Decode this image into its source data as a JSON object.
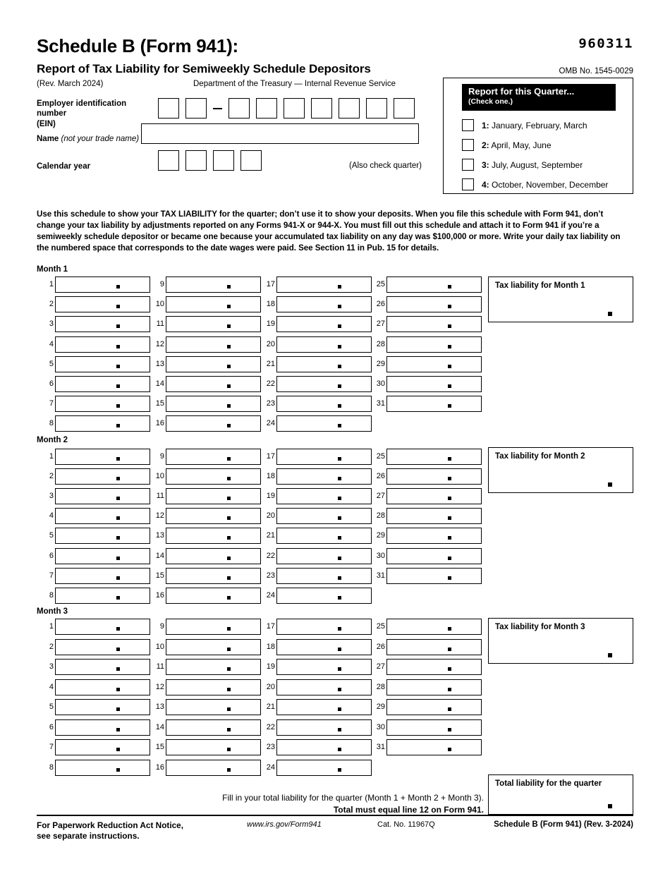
{
  "header": {
    "title": "Schedule B (Form 941):",
    "subtitle": "Report of Tax Liability for Semiweekly Schedule Depositors",
    "revision": "(Rev. March 2024)",
    "agency": "Department of the Treasury  —  Internal Revenue Service",
    "scanline": "960311",
    "omb": "OMB No. 1545-0029"
  },
  "identity": {
    "ein_label_line1": "Employer identification number",
    "ein_label_line2": "(EIN)",
    "ein_boxes_before_dash": 2,
    "ein_boxes_after_dash": 7,
    "ein_value": "",
    "name_label_bold": "Name",
    "name_label_italic": "(not your trade name)",
    "name_value": "",
    "calendar_year_label": "Calendar year",
    "calendar_year_boxes": 4,
    "calendar_year_value": "",
    "also_check_quarter": "(Also check quarter)"
  },
  "quarter": {
    "title": "Report for this Quarter...",
    "subtitle": "(Check one.)",
    "options": [
      {
        "number": "1:",
        "months": "January, February, March",
        "checked": false
      },
      {
        "number": "2:",
        "months": "April, May, June",
        "checked": false
      },
      {
        "number": "3:",
        "months": "July, August, September",
        "checked": false
      },
      {
        "number": "4:",
        "months": "October, November, December",
        "checked": false
      }
    ]
  },
  "instructions": "Use this schedule to show your TAX LIABILITY for the quarter; don’t use it to show your deposits. When you file this schedule with Form 941, don’t change your tax liability by adjustments reported on any Forms 941-X or 944-X. You must fill out this schedule and attach it to Form 941 if you’re a semiweekly schedule depositor or became one because your accumulated tax liability on any day was $100,000 or more. Write your daily tax liability on the numbered space that corresponds to the date wages were paid. See Section 11 in Pub. 15 for details.",
  "months": [
    {
      "label": "Month 1",
      "liability_label": "Tax liability for Month 1",
      "liability_value": "",
      "days": [
        "1",
        "2",
        "3",
        "4",
        "5",
        "6",
        "7",
        "8",
        "9",
        "10",
        "11",
        "12",
        "13",
        "14",
        "15",
        "16",
        "17",
        "18",
        "19",
        "20",
        "21",
        "22",
        "23",
        "24",
        "25",
        "26",
        "27",
        "28",
        "29",
        "30",
        "31"
      ],
      "day_values": [
        "",
        "",
        "",
        "",
        "",
        "",
        "",
        "",
        "",
        "",
        "",
        "",
        "",
        "",
        "",
        "",
        "",
        "",
        "",
        "",
        "",
        "",
        "",
        "",
        "",
        "",
        "",
        "",
        "",
        "",
        ""
      ]
    },
    {
      "label": "Month 2",
      "liability_label": "Tax liability for Month 2",
      "liability_value": "",
      "days": [
        "1",
        "2",
        "3",
        "4",
        "5",
        "6",
        "7",
        "8",
        "9",
        "10",
        "11",
        "12",
        "13",
        "14",
        "15",
        "16",
        "17",
        "18",
        "19",
        "20",
        "21",
        "22",
        "23",
        "24",
        "25",
        "26",
        "27",
        "28",
        "29",
        "30",
        "31"
      ],
      "day_values": [
        "",
        "",
        "",
        "",
        "",
        "",
        "",
        "",
        "",
        "",
        "",
        "",
        "",
        "",
        "",
        "",
        "",
        "",
        "",
        "",
        "",
        "",
        "",
        "",
        "",
        "",
        "",
        "",
        "",
        "",
        ""
      ]
    },
    {
      "label": "Month 3",
      "liability_label": "Tax liability for Month 3",
      "liability_value": "",
      "days": [
        "1",
        "2",
        "3",
        "4",
        "5",
        "6",
        "7",
        "8",
        "9",
        "10",
        "11",
        "12",
        "13",
        "14",
        "15",
        "16",
        "17",
        "18",
        "19",
        "20",
        "21",
        "22",
        "23",
        "24",
        "25",
        "26",
        "27",
        "28",
        "29",
        "30",
        "31"
      ],
      "day_values": [
        "",
        "",
        "",
        "",
        "",
        "",
        "",
        "",
        "",
        "",
        "",
        "",
        "",
        "",
        "",
        "",
        "",
        "",
        "",
        "",
        "",
        "",
        "",
        "",
        "",
        "",
        "",
        "",
        "",
        "",
        ""
      ]
    }
  ],
  "totals": {
    "instruction_line1": "Fill in your total liability for the quarter (Month 1 + Month 2 + Month 3).",
    "instruction_line2": "Total must equal line 12 on Form 941.",
    "total_label": "Total liability for the quarter",
    "total_value": ""
  },
  "footer": {
    "notice_line1": "For Paperwork Reduction Act Notice,",
    "notice_line2": "see separate instructions.",
    "url": "www.irs.gov/Form941",
    "cat_no": "Cat. No. 11967Q",
    "form_ref": "Schedule B (Form 941) (Rev. 3-2024)"
  }
}
